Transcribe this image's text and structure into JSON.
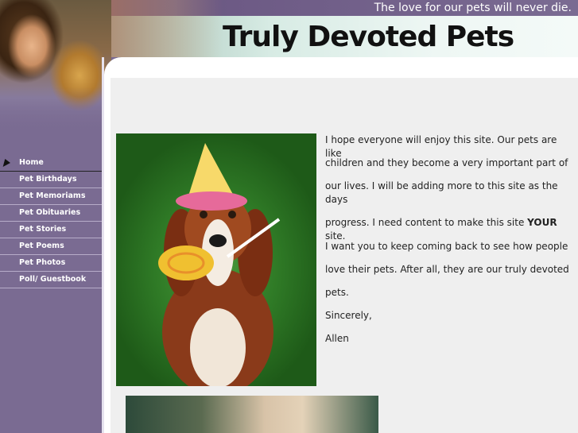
{
  "header": {
    "tagline": "The love for our pets will never die.",
    "title": "Truly Devoted Pets"
  },
  "sidebar": {
    "items": [
      {
        "label": "Home",
        "active": true
      },
      {
        "label": "Pet Birthdays",
        "active": false
      },
      {
        "label": "Pet Memoriams",
        "active": false
      },
      {
        "label": "Pet Obituaries",
        "active": false
      },
      {
        "label": "Pet Stories",
        "active": false
      },
      {
        "label": "Pet Poems",
        "active": false
      },
      {
        "label": "Pet Photos",
        "active": false
      },
      {
        "label": "Poll/ Guestbook",
        "active": false
      }
    ]
  },
  "main": {
    "paragraphs": {
      "p1": "I hope everyone will enjoy this site.  Our pets are like",
      "p2": "children and they become a very important part of",
      "p3": "our lives.  I will be adding more to this site as the days",
      "p4a": "progress.  I need content to make this site ",
      "p4b": "YOUR",
      "p4c": " site.",
      "p5": "I want you to keep coming back to see how people",
      "p6": "love their pets.   After all, they are our truly devoted",
      "p7": "pets.",
      "p8": "Sincerely,",
      "p9": "Allen"
    }
  },
  "colors": {
    "sidebar_bg": "#7a6b92",
    "content_bg": "#efefef",
    "header_bg": "#d7ebe4"
  }
}
